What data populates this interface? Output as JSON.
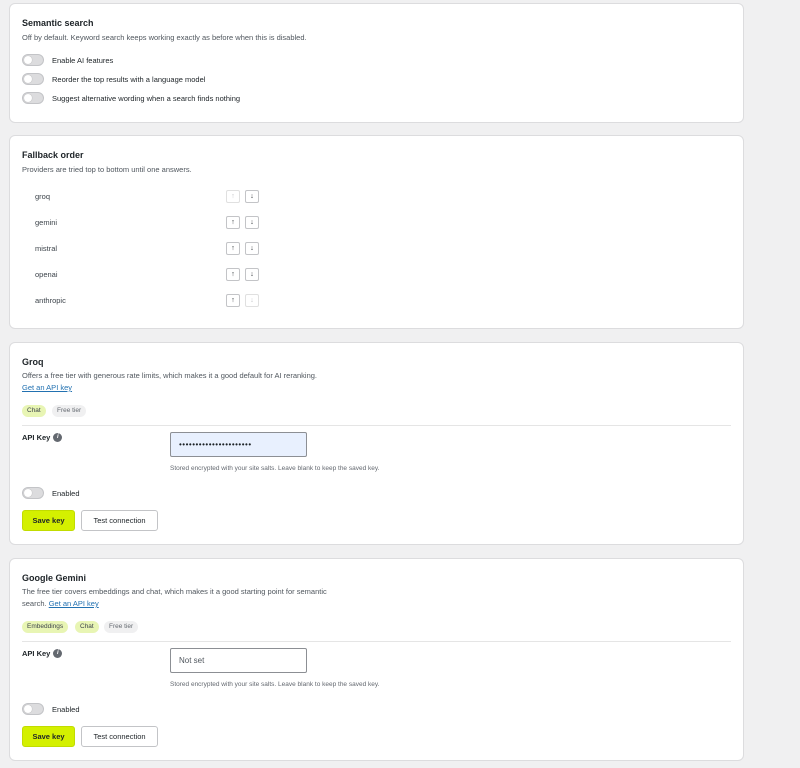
{
  "semantic": {
    "title": "Semantic search",
    "description": "Off by default. Keyword search keeps working exactly as before when this is disabled.",
    "toggles": [
      {
        "label": "Enable AI features"
      },
      {
        "label": "Reorder the top results with a language model"
      },
      {
        "label": "Suggest alternative wording when a search finds nothing"
      }
    ]
  },
  "fallback": {
    "title": "Fallback order",
    "description": "Providers are tried top to bottom until one answers.",
    "providers": [
      {
        "name": "groq",
        "up": "↑",
        "down": "↓"
      },
      {
        "name": "gemini",
        "up": "↑",
        "down": "↓"
      },
      {
        "name": "mistral",
        "up": "↑",
        "down": "↓"
      },
      {
        "name": "openai",
        "up": "↑",
        "down": "↓"
      },
      {
        "name": "anthropic",
        "up": "↑",
        "down": "↓"
      }
    ]
  },
  "groq": {
    "title": "Groq",
    "description": "Offers a free tier with generous rate limits, which makes it a good default for AI reranking.",
    "link": "Get an API key",
    "badges": [
      "Chat",
      "Free tier"
    ],
    "api_label": "API Key",
    "api_value": "••••••••••••••••••••••",
    "help": "Stored encrypted with your site salts. Leave blank to keep the saved key.",
    "enabled_label": "Enabled",
    "save_label": "Save key",
    "test_label": "Test connection"
  },
  "gemini": {
    "title": "Google Gemini",
    "description": "The free tier covers embeddings and chat, which makes it a good starting point for semantic search.",
    "link": "Get an API key",
    "badges": [
      "Embeddings",
      "Chat",
      "Free tier"
    ],
    "api_label": "API Key",
    "api_placeholder": "Not set",
    "help": "Stored encrypted with your site salts. Leave blank to keep the saved key.",
    "enabled_label": "Enabled",
    "save_label": "Save key",
    "test_label": "Test connection"
  }
}
